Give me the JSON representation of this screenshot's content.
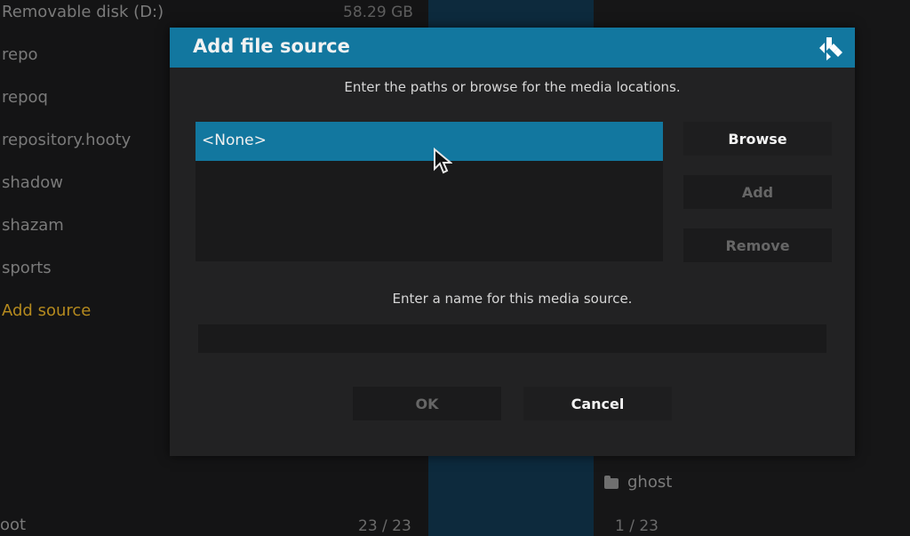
{
  "background": {
    "list_items": [
      {
        "label": "Removable disk (D:)"
      },
      {
        "label": "repo"
      },
      {
        "label": "repoq"
      },
      {
        "label": "repository.hooty"
      },
      {
        "label": "shadow"
      },
      {
        "label": "shazam"
      },
      {
        "label": "sports"
      },
      {
        "label": "Add source"
      }
    ],
    "disk_size": "58.29 GB",
    "right_item": "ghost",
    "footer_left": "oot",
    "left_count": "23 / 23",
    "right_count": "1 / 23"
  },
  "dialog": {
    "title": "Add file source",
    "paths_instruction": "Enter the paths or browse for the media locations.",
    "paths": [
      "<None>"
    ],
    "browse_label": "Browse",
    "add_label": "Add",
    "remove_label": "Remove",
    "name_instruction": "Enter a name for this media source.",
    "name_value": "",
    "ok_label": "OK",
    "cancel_label": "Cancel"
  },
  "colors": {
    "accent": "#12779f",
    "highlight": "#b58a1e"
  }
}
